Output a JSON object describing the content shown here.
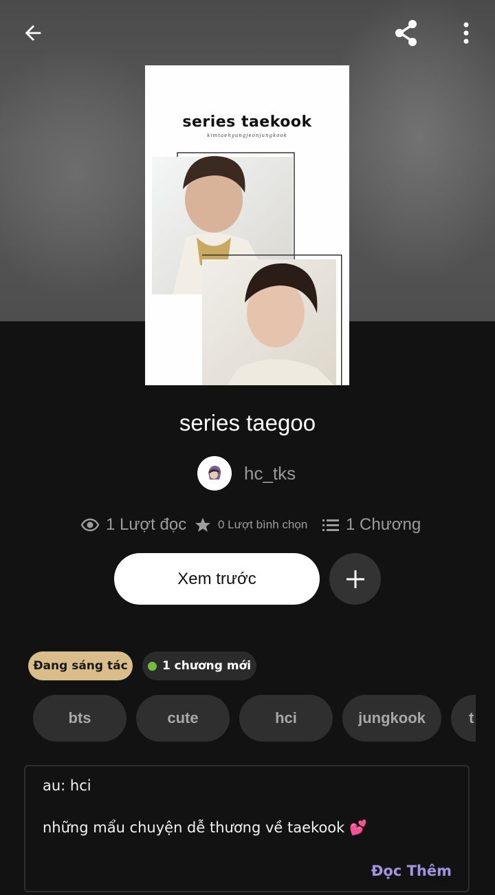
{
  "header": {
    "back_icon": "arrow-left-icon",
    "share_icon": "share-icon",
    "menu_icon": "more-vertical-icon"
  },
  "cover": {
    "title": "series taekook",
    "subtitle": "kimtaehyungjeonjungkook"
  },
  "story": {
    "title": "series taegoo",
    "author": "hc_tks"
  },
  "stats": {
    "reads": "1 Lượt đọc",
    "votes": "0 Lượt bình chọn",
    "chapters": "1 Chương"
  },
  "actions": {
    "preview_label": "Xem trước",
    "add_icon": "plus-icon"
  },
  "badges": {
    "status": "Đang sáng tác",
    "new_chapters": "1 chương mới"
  },
  "tags": [
    "bts",
    "cute",
    "hci",
    "jungkook",
    "t"
  ],
  "description": {
    "line1": "au: hci",
    "line2": "những mẩu chuyện dễ thương về taekook 💕",
    "read_more": "Đọc Thêm"
  },
  "colors": {
    "background": "#121212",
    "status_badge": "#d9bd8a",
    "new_dot": "#6fbf3a",
    "read_more": "#a493e0"
  }
}
